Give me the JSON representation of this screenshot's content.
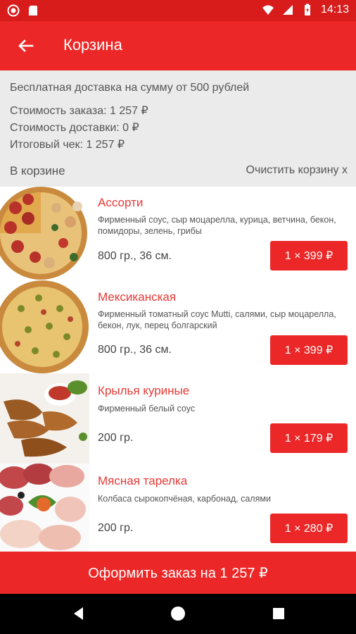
{
  "status": {
    "time": "14:13"
  },
  "appbar": {
    "title": "Корзина"
  },
  "summary": {
    "delivery_note": "Бесплатная доставка на сумму от 500 рублей",
    "order_cost": "Стоимость заказа: 1 257 ₽",
    "delivery_cost": "Стоимость доставки: 0 ₽",
    "total": "Итоговый чек: 1 257 ₽",
    "in_cart": "В корзине",
    "clear_cart": "Очистить корзину х"
  },
  "items": [
    {
      "name": "Ассорти",
      "desc": "Фирменный соус, сыр моцарелла, курица, ветчина, бекон, помидоры, зелень, грибы",
      "meta": "800 гр., 36 см.",
      "price": "1 × 399 ₽",
      "image": "pizza-assorti"
    },
    {
      "name": "Мексиканская",
      "desc": "Фирменный томатный соус Mutti, салями, сыр моцарелла, бекон, лук, перец болгарский",
      "meta": "800 гр., 36 см.",
      "price": "1 × 399 ₽",
      "image": "pizza-mexican"
    },
    {
      "name": "Крылья куриные",
      "desc": "Фирменный белый соус",
      "meta": "200 гр.",
      "price": "1 × 179 ₽",
      "image": "chicken-wings"
    },
    {
      "name": "Мясная тарелка",
      "desc": "Колбаса сырокопчёная, карбонад, салями",
      "meta": "200 гр.",
      "price": "1 × 280 ₽",
      "image": "meat-plate"
    }
  ],
  "checkout": {
    "label": "Оформить заказ на 1 257 ₽"
  },
  "colors": {
    "primary": "#ec2727",
    "statusbar": "#d81b1b",
    "accent_text": "#e53935"
  }
}
